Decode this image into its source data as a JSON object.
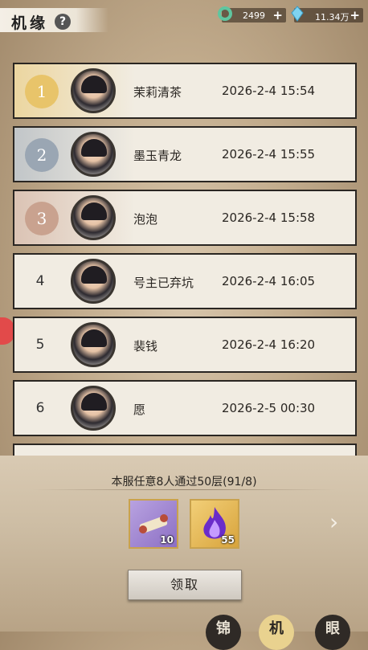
{
  "header": {
    "title": "机缘",
    "help_symbol": "?",
    "jade": {
      "icon": "jade-ring-icon",
      "value": "2499",
      "plus": "+"
    },
    "crystal": {
      "icon": "crystal-icon",
      "value": "11.34万",
      "plus": "+"
    }
  },
  "ranking": [
    {
      "rank": "1",
      "name": "茉莉清茶",
      "time": "2026-2-4 15:54",
      "medal": "gold"
    },
    {
      "rank": "2",
      "name": "墨玉青龙",
      "time": "2026-2-4 15:55",
      "medal": "silver"
    },
    {
      "rank": "3",
      "name": "泡泡",
      "time": "2026-2-4 15:58",
      "medal": "bronze"
    },
    {
      "rank": "4",
      "name": "号主已弃坑",
      "time": "2026-2-4 16:05",
      "medal": ""
    },
    {
      "rank": "5",
      "name": "裴钱",
      "time": "2026-2-4 16:20",
      "medal": ""
    },
    {
      "rank": "6",
      "name": "愿",
      "time": "2026-2-5 00:30",
      "medal": ""
    }
  ],
  "task": {
    "description": "本服任意8人通过50层(91/8)",
    "rewards": [
      {
        "icon": "scroll-item-icon",
        "count": "10"
      },
      {
        "icon": "purple-flame-icon",
        "count": "55"
      }
    ],
    "claim_label": "领取"
  },
  "bottom_tabs": [
    "锦",
    "机",
    "眼"
  ],
  "colors": {
    "gold": "#e8c46a",
    "silver": "#9aa6b3",
    "bronze": "#c9a28f"
  }
}
